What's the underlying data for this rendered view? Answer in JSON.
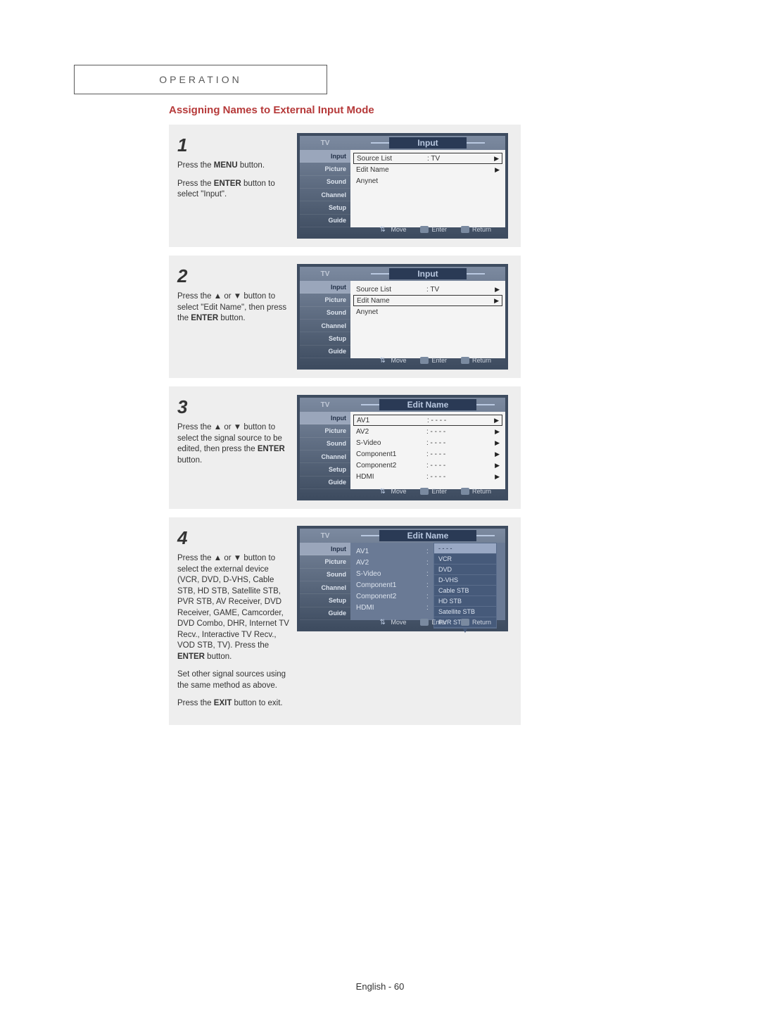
{
  "chapter": "OPERATION",
  "section_title": "Assigning Names to External Input Mode",
  "footer": "English - 60",
  "sidebar": [
    "Input",
    "Picture",
    "Sound",
    "Channel",
    "Setup",
    "Guide"
  ],
  "tv_label": "TV",
  "footbar": {
    "move": "Move",
    "enter": "Enter",
    "return": "Return"
  },
  "steps": [
    {
      "num": "1",
      "parts": [
        [
          {
            "t": "Press the "
          },
          {
            "t": "MENU",
            "b": true
          },
          {
            "t": " button."
          }
        ],
        [
          {
            "t": "Press the "
          },
          {
            "t": "ENTER",
            "b": true
          },
          {
            "t": " button to select \"Input\"."
          }
        ]
      ],
      "osd": {
        "title": "Input",
        "selected_tab": 0,
        "panel": {
          "boxed_index": 0,
          "dark": false,
          "rows": [
            {
              "name": "Source List",
              "val": ": TV",
              "arr": "▶"
            },
            {
              "name": "Edit Name",
              "val": "",
              "arr": "▶"
            },
            {
              "name": "Anynet",
              "val": "",
              "arr": ""
            }
          ]
        }
      }
    },
    {
      "num": "2",
      "parts": [
        [
          {
            "t": "Press the ▲ or ▼ button to select \"Edit Name\", then press the "
          },
          {
            "t": "ENTER",
            "b": true
          },
          {
            "t": " button."
          }
        ]
      ],
      "osd": {
        "title": "Input",
        "selected_tab": 0,
        "panel": {
          "boxed_index": 1,
          "dark": false,
          "rows": [
            {
              "name": "Source List",
              "val": ": TV",
              "arr": "▶"
            },
            {
              "name": "Edit Name",
              "val": "",
              "arr": "▶"
            },
            {
              "name": "Anynet",
              "val": "",
              "arr": ""
            }
          ]
        }
      }
    },
    {
      "num": "3",
      "parts": [
        [
          {
            "t": "Press the ▲ or ▼ button to select the signal source to be edited, then press the "
          },
          {
            "t": "ENTER",
            "b": true
          },
          {
            "t": " button."
          }
        ]
      ],
      "osd": {
        "title": "Edit Name",
        "selected_tab": 0,
        "panel": {
          "boxed_index": 0,
          "dark": false,
          "rows": [
            {
              "name": "AV1",
              "val": ": - - - -",
              "arr": "▶"
            },
            {
              "name": "AV2",
              "val": ": - - - -",
              "arr": "▶"
            },
            {
              "name": "S-Video",
              "val": ": - - - -",
              "arr": "▶"
            },
            {
              "name": "Component1",
              "val": ": - - - -",
              "arr": "▶"
            },
            {
              "name": "Component2",
              "val": ": - - - -",
              "arr": "▶"
            },
            {
              "name": "HDMI",
              "val": ": - - - -",
              "arr": "▶"
            }
          ]
        }
      }
    },
    {
      "num": "4",
      "parts": [
        [
          {
            "t": "Press the ▲ or ▼ button to select the external device (VCR, DVD, D-VHS, Cable STB, HD STB, Satellite STB, PVR STB, AV Receiver, DVD Receiver, GAME, Camcorder, DVD Combo, DHR, Internet TV Recv., Interactive TV Recv., VOD STB, TV). Press the "
          },
          {
            "t": "ENTER",
            "b": true
          },
          {
            "t": " button."
          }
        ],
        [
          {
            "t": "Set other signal sources using the same method as above."
          }
        ],
        [
          {
            "t": "Press the "
          },
          {
            "t": "EXIT",
            "b": true
          },
          {
            "t": " button to exit."
          }
        ]
      ],
      "osd": {
        "title": "Edit Name",
        "selected_tab": 0,
        "panel": {
          "boxed_index": -1,
          "dark": true,
          "rows": [
            {
              "name": "AV1",
              "val": ":",
              "arr": ""
            },
            {
              "name": "AV2",
              "val": ":",
              "arr": ""
            },
            {
              "name": "S-Video",
              "val": ":",
              "arr": ""
            },
            {
              "name": "Component1",
              "val": ":",
              "arr": ""
            },
            {
              "name": "Component2",
              "val": ":",
              "arr": ""
            },
            {
              "name": "HDMI",
              "val": ":",
              "arr": ""
            }
          ],
          "dropdown": {
            "selected": 0,
            "items": [
              "- - - -",
              "VCR",
              "DVD",
              "D-VHS",
              "Cable STB",
              "HD STB",
              "Satellite STB",
              "PVR STB"
            ],
            "more": "▼"
          }
        }
      }
    }
  ]
}
